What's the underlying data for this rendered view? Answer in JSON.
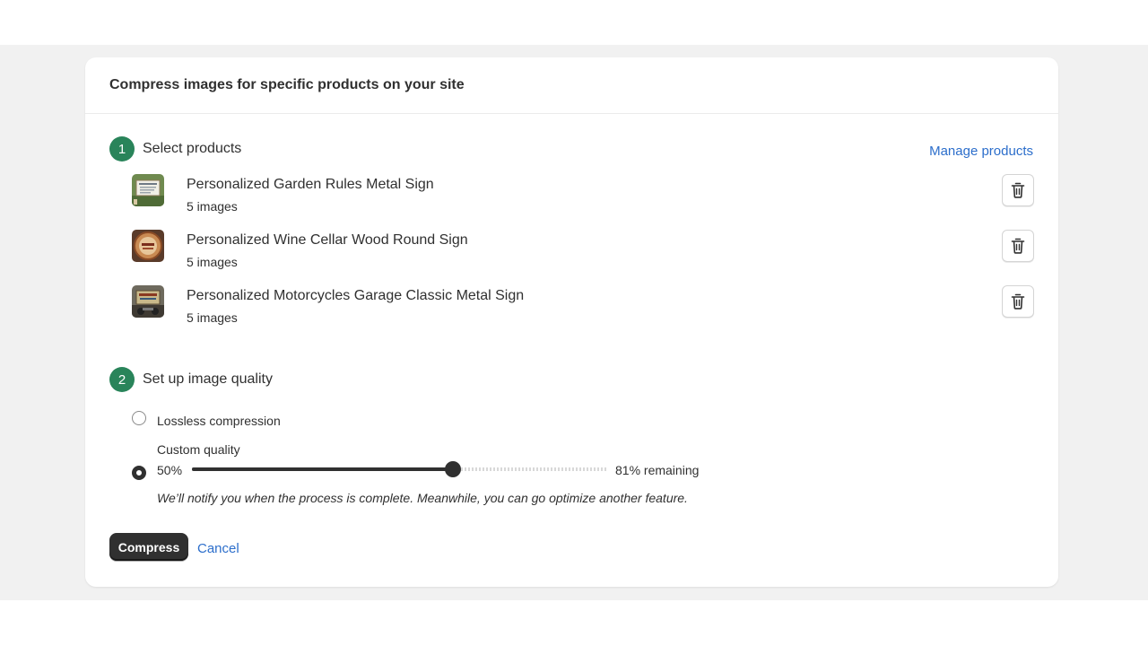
{
  "card": {
    "title": "Compress images for specific products on your site"
  },
  "step1": {
    "number": "1",
    "title": "Select products",
    "manage_link": "Manage products"
  },
  "products": [
    {
      "name": "Personalized Garden Rules Metal Sign",
      "count": "5 images"
    },
    {
      "name": "Personalized Wine Cellar Wood Round Sign",
      "count": "5 images"
    },
    {
      "name": "Personalized Motorcycles Garage Classic Metal Sign",
      "count": "5 images"
    }
  ],
  "step2": {
    "number": "2",
    "title": "Set up image quality",
    "lossless_label": "Lossless compression",
    "lossless_selected": false,
    "custom_label": "Custom quality",
    "custom_selected": true,
    "quality_value": "50%",
    "quality_percent": 50,
    "slider_fill_fraction": 0.63,
    "remaining": "81% remaining",
    "note": "We’ll notify you when the process is complete. Meanwhile, you can go optimize another feature."
  },
  "actions": {
    "compress_label": "Compress",
    "cancel_label": "Cancel"
  },
  "icons": {
    "delete": "trash-icon"
  },
  "colors": {
    "step_badge": "#29845a",
    "link": "#2c6ecb",
    "primary_button": "#303030"
  }
}
